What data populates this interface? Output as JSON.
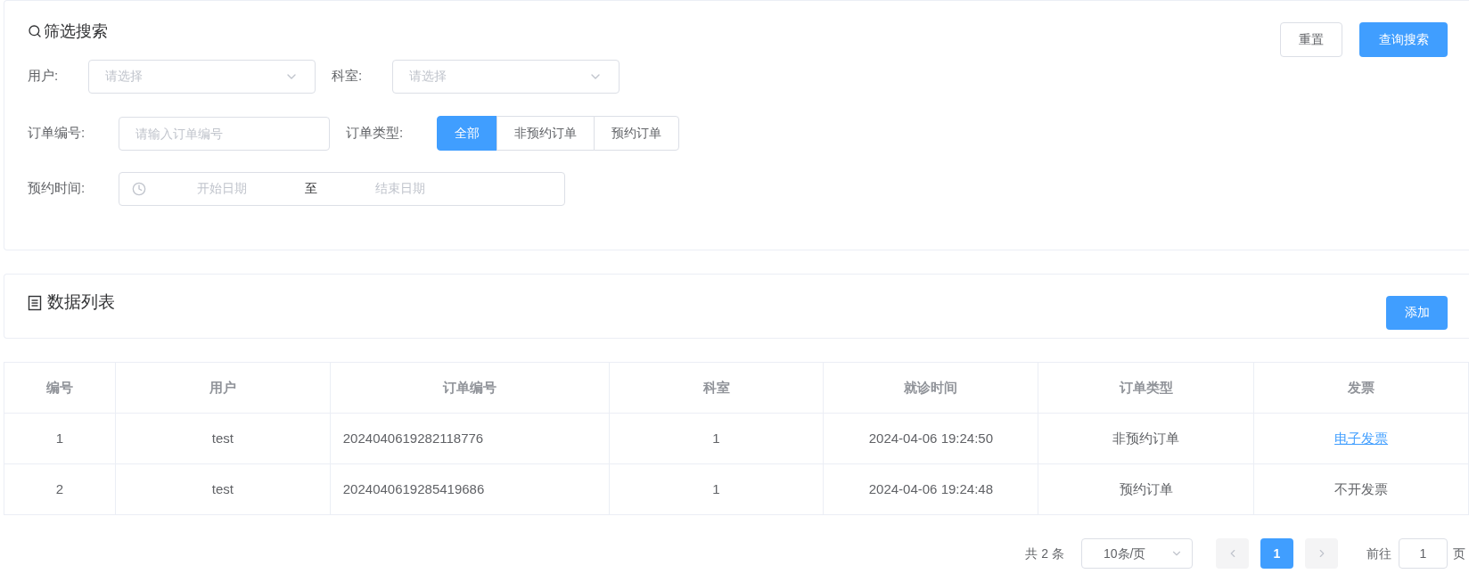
{
  "filter": {
    "title": "筛选搜索",
    "user": {
      "label": "用户:",
      "placeholder": "请选择"
    },
    "dept": {
      "label": "科室:",
      "placeholder": "请选择"
    },
    "order_no": {
      "label": "订单编号:",
      "placeholder": "请输入订单编号"
    },
    "order_type": {
      "label": "订单类型:",
      "options": [
        {
          "label": "全部",
          "selected": true
        },
        {
          "label": "非预约订单",
          "selected": false
        },
        {
          "label": "预约订单",
          "selected": false
        }
      ]
    },
    "time": {
      "label": "预约时间:",
      "start_placeholder": "开始日期",
      "separator": "至",
      "end_placeholder": "结束日期"
    },
    "buttons": [
      {
        "label": "重置",
        "kind": "plain"
      },
      {
        "label": "查询搜索",
        "kind": "primary"
      }
    ]
  },
  "list": {
    "title": "数据列表",
    "add_button": "添加"
  },
  "table": {
    "columns": [
      "编号",
      "用户",
      "订单编号",
      "科室",
      "就诊时间",
      "订单类型",
      "发票"
    ],
    "rows": [
      {
        "cells": [
          "1",
          "test",
          "2024040619282118776",
          "1",
          "2024-04-06 19:24:50",
          "非预约订单"
        ],
        "invoice": {
          "text": "电子发票",
          "kind": "link"
        }
      },
      {
        "cells": [
          "2",
          "test",
          "2024040619285419686",
          "1",
          "2024-04-06 19:24:48",
          "预约订单"
        ],
        "invoice": {
          "text": "不开发票",
          "kind": "text"
        }
      }
    ]
  },
  "pagination": {
    "total": "共 2 条",
    "page_size": "10条/页",
    "pages": [
      {
        "label": "1",
        "selected": true
      }
    ],
    "goto_label": "前往",
    "goto_value": "1",
    "page_suffix": "页"
  }
}
